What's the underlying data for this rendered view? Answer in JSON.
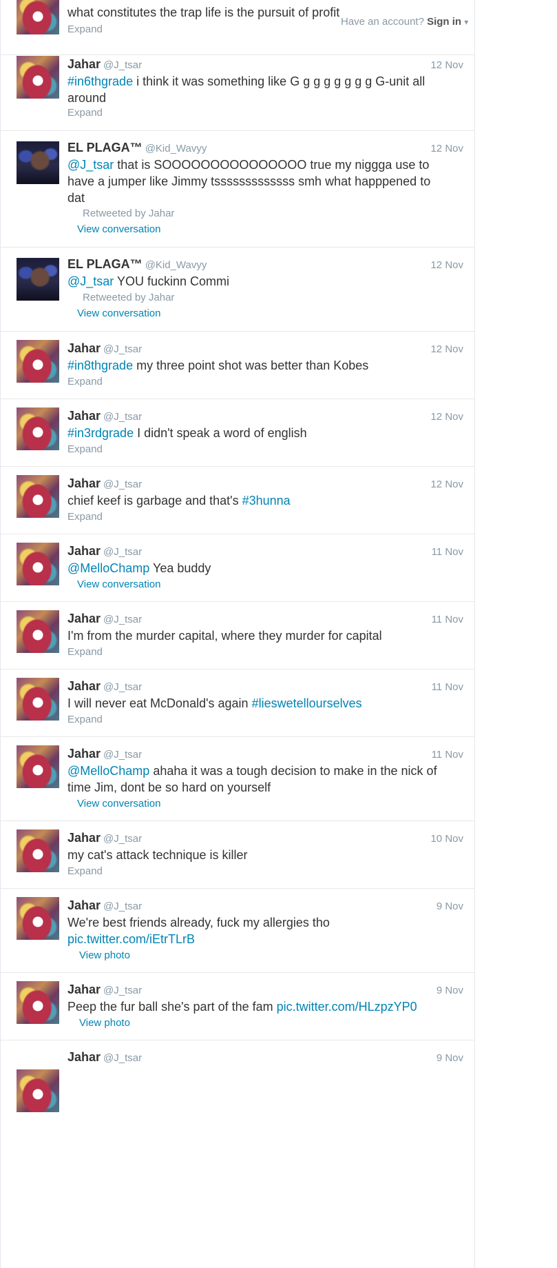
{
  "topbar": {
    "prompt": "Have an account?",
    "signin": "Sign in",
    "caret": "▾"
  },
  "tweets": [
    {
      "text": "what constitutes the trap life is the pursuit of profit",
      "action": "Expand"
    },
    {
      "name": "Jahar",
      "handle": "@J_tsar",
      "date": "12 Nov",
      "tag": "#in6thgrade",
      "text": " i think it was something like G g g g g g g g G-unit all around",
      "action": "Expand"
    },
    {
      "name": "EL PLAGA™",
      "handle": "@Kid_Wavyy",
      "date": "12 Nov",
      "mention": "@J_tsar",
      "text": " that is SOOOOOOOOOOOOOOO true my niggga use to have a jumper like Jimmy tsssssssssssss smh what happpened to dat",
      "retweeted": "Retweeted by Jahar",
      "action": "View conversation"
    },
    {
      "name": "EL PLAGA™",
      "handle": "@Kid_Wavyy",
      "date": "12 Nov",
      "mention": "@J_tsar",
      "text": " YOU fuckinn Commi",
      "retweeted": "Retweeted by Jahar",
      "action": "View conversation"
    },
    {
      "name": "Jahar",
      "handle": "@J_tsar",
      "date": "12 Nov",
      "tag": "#in8thgrade",
      "text": " my three point shot was better than Kobes",
      "action": "Expand"
    },
    {
      "name": "Jahar",
      "handle": "@J_tsar",
      "date": "12 Nov",
      "tag": "#in3rdgrade",
      "text": " I didn't speak a word of english",
      "action": "Expand"
    },
    {
      "name": "Jahar",
      "handle": "@J_tsar",
      "date": "12 Nov",
      "text": "chief keef is garbage and that's ",
      "tag": "#3hunna",
      "action": "Expand"
    },
    {
      "name": "Jahar",
      "handle": "@J_tsar",
      "date": "11 Nov",
      "mention": "@MelloChamp",
      "text": " Yea buddy",
      "action": "View conversation"
    },
    {
      "name": "Jahar",
      "handle": "@J_tsar",
      "date": "11 Nov",
      "text": "I'm from the murder capital, where they murder for capital",
      "action": "Expand"
    },
    {
      "name": "Jahar",
      "handle": "@J_tsar",
      "date": "11 Nov",
      "text": "I will never eat McDonald's again ",
      "tag": "#lieswetellourselves",
      "action": "Expand"
    },
    {
      "name": "Jahar",
      "handle": "@J_tsar",
      "date": "11 Nov",
      "mention": "@MelloChamp",
      "text": " ahaha it was a tough decision to make in the nick of time Jim, dont be so hard on yourself",
      "action": "View conversation"
    },
    {
      "name": "Jahar",
      "handle": "@J_tsar",
      "date": "10 Nov",
      "text": "my cat's attack technique is killer",
      "action": "Expand"
    },
    {
      "name": "Jahar",
      "handle": "@J_tsar",
      "date": "9 Nov",
      "text": "We're best friends already, fuck my allergies tho ",
      "pic": "pic.twitter.com/iEtrTLrB",
      "action": "View photo"
    },
    {
      "name": "Jahar",
      "handle": "@J_tsar",
      "date": "9 Nov",
      "text": "Peep the fur ball she's part of the fam ",
      "pic": "pic.twitter.com/HLzpzYP0",
      "action": "View photo"
    },
    {
      "name": "Jahar",
      "handle": "@J_tsar",
      "date": "9 Nov"
    }
  ]
}
